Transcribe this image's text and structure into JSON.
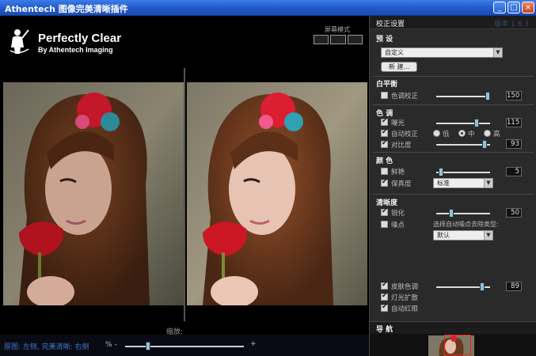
{
  "window": {
    "title": "Athentech 图像完美清晰插件",
    "minimize": "_",
    "maximize": "□",
    "close": "×"
  },
  "logo": {
    "name": "Perfectly Clear",
    "sub": "By Athentech Imaging"
  },
  "viewer": {
    "screen_mode_label": "屏幕模式",
    "zoom_label": "缩放:",
    "legend": "原图: 左侧, 完美清晰: 右侧",
    "zoom_pct": "% -",
    "zoom_plus": "+",
    "zoom_level": 0.18
  },
  "panel": {
    "title": "校正设置",
    "version": "版本 1.6.3",
    "preset": {
      "title": "预 设",
      "value": "自定义",
      "new_button": "新 建..."
    },
    "white_balance": {
      "title": "白平衡",
      "tint_label": "色调校正",
      "tint_checked": false,
      "tint_value": "150",
      "tint_level": 1.0
    },
    "tone": {
      "title": "色 调",
      "exposure_label": "曝光",
      "exposure_checked": true,
      "exposure_value": "115",
      "exposure_level": 0.77,
      "auto_label": "自动校正",
      "auto_checked": true,
      "auto_options": [
        "低",
        "中",
        "高"
      ],
      "auto_selected": "中",
      "contrast_label": "对比度",
      "contrast_checked": true,
      "contrast_value": "93",
      "contrast_level": 0.93
    },
    "color": {
      "title": "颜 色",
      "vibrance_label": "鲜艳",
      "vibrance_checked": false,
      "vibrance_value": "5",
      "vibrance_level": 0.05,
      "fidelity_label": "保真度",
      "fidelity_checked": true,
      "fidelity_value": "标准"
    },
    "sharpness": {
      "title": "清晰度",
      "sharpen_label": "锐化",
      "sharpen_checked": true,
      "sharpen_value": "50",
      "sharpen_level": 0.25,
      "noise_label": "噪点",
      "noise_checked": false,
      "noise_type_label": "选择自动噪点去除类型:",
      "noise_type_value": "默认"
    },
    "extras": {
      "skin_label": "皮肤色调",
      "skin_checked": true,
      "skin_value": "89",
      "skin_level": 0.89,
      "light_label": "灯光扩散",
      "light_checked": true,
      "redeye_label": "自动红眼",
      "redeye_checked": true
    },
    "navigator": {
      "title": "导 航"
    }
  },
  "colors": {
    "titlebar": "#245edb",
    "panel_bg": "#2a2a2a",
    "slider_thumb": "#8ec4e0",
    "legend_text": "#3f79c7"
  }
}
